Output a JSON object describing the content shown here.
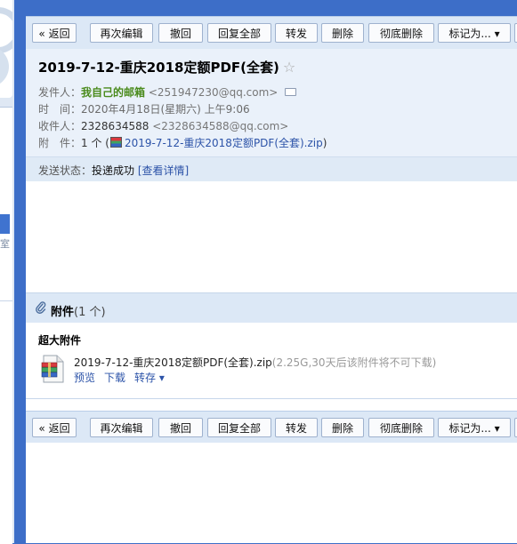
{
  "toolbar": {
    "back": "« 返回",
    "reedit": "再次编辑",
    "recall": "撤回",
    "reply_all": "回复全部",
    "forward": "转发",
    "delete": "删除",
    "delete_perm": "彻底删除",
    "mark_as": "标记为... ▾"
  },
  "mail": {
    "subject": "2019-7-12-重庆2018定额PDF(全套)",
    "star": "☆",
    "from_label": "发件人：",
    "from_name": "我自己的邮箱",
    "from_addr": "<251947230@qq.com>",
    "time_label": "时　间：",
    "time_value": "2020年4月18日(星期六) 上午9:06",
    "to_label": "收件人：",
    "to_name": "2328634588",
    "to_addr": "<2328634588@qq.com>",
    "att_label": "附　件：",
    "att_count": "1 个 (",
    "att_file": "2019-7-12-重庆2018定额PDF(全套).zip",
    "att_close": ")",
    "status_label": "发送状态：",
    "status_value": "投递成功",
    "status_link": "[查看详情]"
  },
  "attachments": {
    "title": "附件",
    "count": "(1 个)",
    "super_label": "超大附件",
    "file_name": "2019-7-12-重庆2018定额PDF(全套).zip",
    "file_note": "(2.25G,30天后该附件将不可下载)",
    "preview": "预览",
    "download": "下载",
    "save": "转存 ▾"
  },
  "left": {
    "clip_text": "室"
  },
  "colors": {
    "accent": "#3d6ec8",
    "link": "#2c53a8",
    "sender": "#4a8b1c"
  }
}
